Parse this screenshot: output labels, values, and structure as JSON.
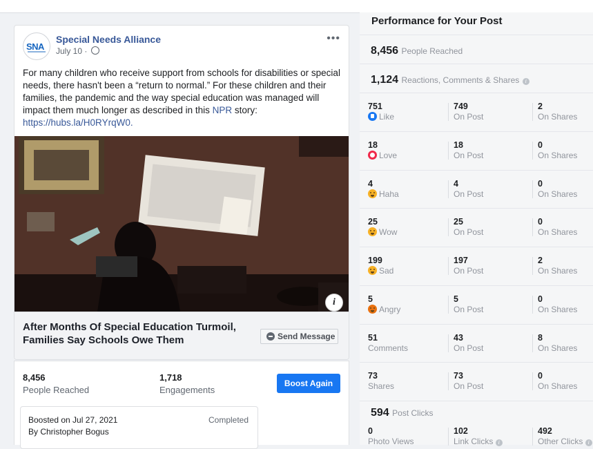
{
  "post": {
    "page_name": "Special Needs Alliance",
    "avatar_text": "SNA",
    "date": "July 10 · ",
    "more": "•••",
    "text_main": "For many children who receive support from schools for disabilities or special needs, there hasn't been a “return to normal.” For these children and their families, the pandemic and the way special education was managed will impact them much longer as described in this ",
    "link_npr": "NPR",
    "text_after_link": " story: ",
    "short_url": "https://hubs.la/H0RYrqW0.",
    "link_title": "After Months Of Special Education Turmoil, Families Say Schools Owe Them",
    "send_message": "Send Message",
    "info": "i"
  },
  "summary": {
    "people_reached": "8,456",
    "people_reached_label": "People Reached",
    "engagements": "1,718",
    "engagements_label": "Engagements",
    "boost_again": "Boost Again",
    "boosted_on": "Boosted on Jul 27, 2021",
    "boosted_by": "By Christopher Bogus",
    "status": "Completed"
  },
  "performance": {
    "title": "Performance for Your Post",
    "reached": "8,456",
    "reached_label": "People Reached",
    "reactions_total": "1,124",
    "reactions_label": "Reactions, Comments & Shares",
    "rows": [
      {
        "total": "751",
        "label": "Like",
        "icon": "like-icon",
        "on_post": "749",
        "on_shares": "2"
      },
      {
        "total": "18",
        "label": "Love",
        "icon": "love-icon",
        "on_post": "18",
        "on_shares": "0"
      },
      {
        "total": "4",
        "label": "Haha",
        "icon": "haha-icon",
        "on_post": "4",
        "on_shares": "0"
      },
      {
        "total": "25",
        "label": "Wow",
        "icon": "wow-icon",
        "on_post": "25",
        "on_shares": "0"
      },
      {
        "total": "199",
        "label": "Sad",
        "icon": "sad-icon",
        "on_post": "197",
        "on_shares": "2"
      },
      {
        "total": "5",
        "label": "Angry",
        "icon": "angry-icon",
        "on_post": "5",
        "on_shares": "0"
      },
      {
        "total": "51",
        "label": "Comments",
        "icon": "",
        "on_post": "43",
        "on_shares": "8"
      },
      {
        "total": "73",
        "label": "Shares",
        "icon": "",
        "on_post": "73",
        "on_shares": "0"
      }
    ],
    "on_post_label": "On Post",
    "on_shares_label": "On Shares",
    "post_clicks": "594",
    "post_clicks_label": "Post Clicks",
    "photo_views": "0",
    "photo_views_label": "Photo Views",
    "link_clicks": "102",
    "link_clicks_label": "Link Clicks",
    "other_clicks": "492",
    "other_clicks_label": "Other Clicks"
  },
  "colors": {
    "link": "#385898",
    "accent": "#1877f2"
  }
}
